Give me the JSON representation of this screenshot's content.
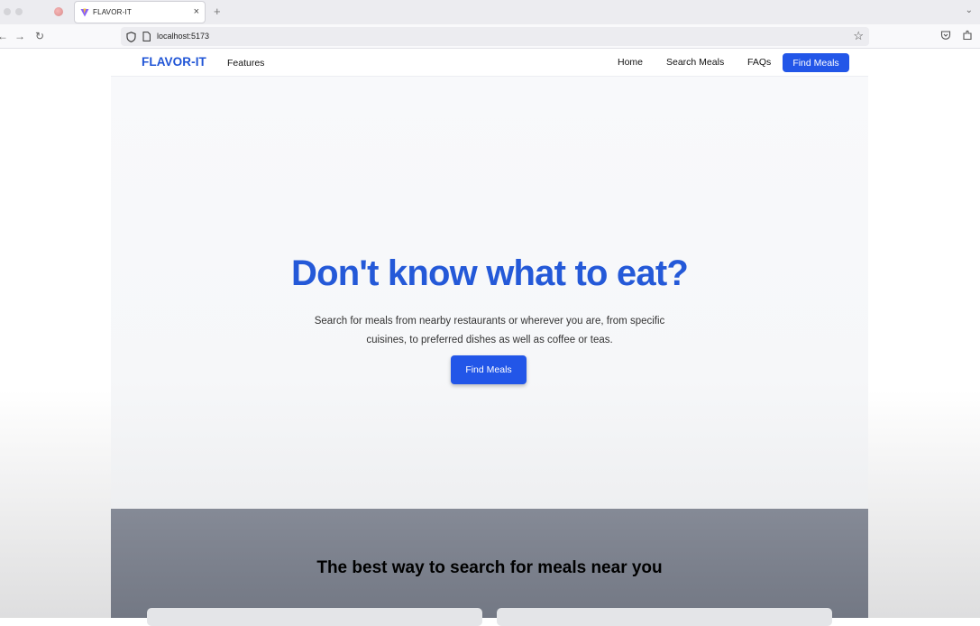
{
  "browser": {
    "tab_title": "FLAVOR-IT",
    "tab_close": "×",
    "new_tab": "+",
    "tab_list": "⌄",
    "back": "←",
    "forward": "→",
    "reload": "↻",
    "url": "localhost:5173",
    "bookmark_star": "☆"
  },
  "site": {
    "brand": "FLAVOR-IT",
    "nav": {
      "features": "Features",
      "home": "Home",
      "search_meals": "Search Meals",
      "faqs": "FAQs",
      "cta": "Find Meals"
    },
    "hero": {
      "title": "Don't know what to eat?",
      "text": "Search for meals from nearby restaurants or wherever you are, from specific cuisines, to preferred dishes as well as coffee or teas.",
      "cta": "Find Meals"
    },
    "features_section": {
      "title": "The best way to search for meals near you"
    }
  },
  "colors": {
    "brand": "#2055d6",
    "accent": "#2256e8",
    "features_bg": "#7a7f8b"
  }
}
